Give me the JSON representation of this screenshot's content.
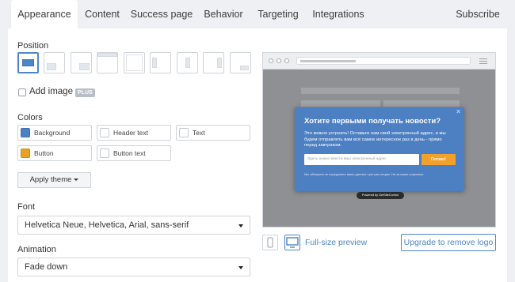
{
  "tabs": [
    {
      "label": "Appearance",
      "active": true
    },
    {
      "label": "Content"
    },
    {
      "label": "Success page"
    },
    {
      "label": "Behavior"
    },
    {
      "label": "Targeting"
    },
    {
      "label": "Integrations"
    }
  ],
  "subscribe_link": "Subscribe",
  "position": {
    "label": "Position",
    "options": [
      "center-modal",
      "bottom-left",
      "bottom-center",
      "top-bar",
      "fullscreen",
      "left-slide",
      "center-slide",
      "right-slide",
      "bottom-right"
    ],
    "selected": "center-modal"
  },
  "add_image": {
    "label": "Add image",
    "badge": "PLUS",
    "checked": false
  },
  "colors": {
    "label": "Colors",
    "fields": [
      {
        "label": "Background",
        "color": "#4d7fc3"
      },
      {
        "label": "Header text",
        "color": "#ffffff"
      },
      {
        "label": "Text",
        "color": "#ffffff"
      },
      {
        "label": "Button",
        "color": "#e7a224"
      },
      {
        "label": "Button text",
        "color": "#ffffff"
      }
    ]
  },
  "apply_theme": "Apply theme",
  "font": {
    "label": "Font",
    "value": "Helvetica Neue, Helvetica, Arial, sans-serif"
  },
  "animation": {
    "label": "Animation",
    "value": "Fade down"
  },
  "preview": {
    "popup_title": "Хотите первыми получать новости?",
    "popup_text": "Это можно устроить! Оставьте нам свой электронный адрес, и мы будем отправлять вам всё самое интересное раз в день - прямо перед завтраком.",
    "email_placeholder": "Здесь нужно ввести ваш электронный адрес",
    "submit_label": "Готово!",
    "privacy_note": "Мы обещаем не передавать ваши данные третьим лицам. Ни за какие коврижки.",
    "powered_by": "Powered by GetSiteControl",
    "close_glyph": "✕"
  },
  "full_size_preview": "Full-size preview",
  "upgrade_button": "Upgrade to remove logo"
}
